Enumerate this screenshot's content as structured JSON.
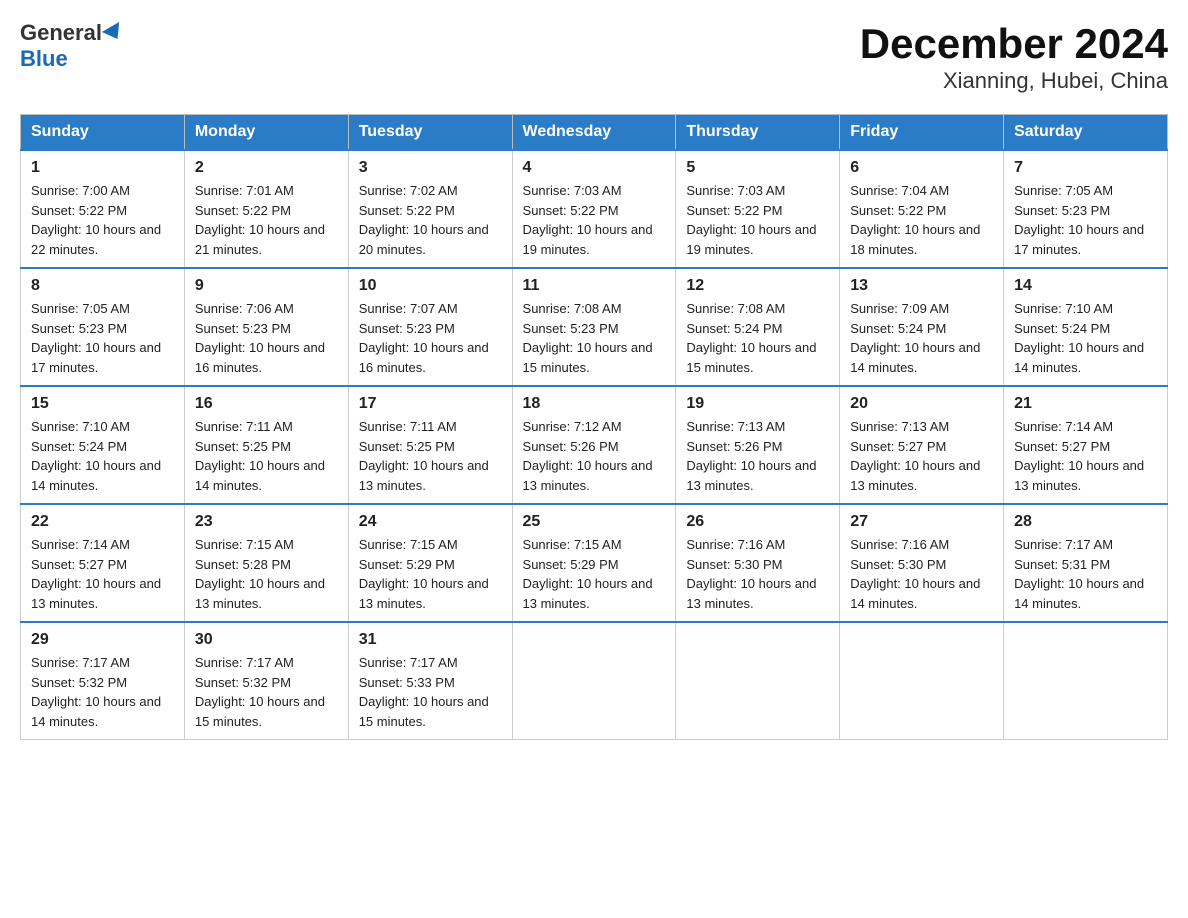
{
  "header": {
    "title": "December 2024",
    "subtitle": "Xianning, Hubei, China",
    "logo_general": "General",
    "logo_blue": "Blue"
  },
  "weekdays": [
    "Sunday",
    "Monday",
    "Tuesday",
    "Wednesday",
    "Thursday",
    "Friday",
    "Saturday"
  ],
  "weeks": [
    [
      {
        "day": "1",
        "sunrise": "7:00 AM",
        "sunset": "5:22 PM",
        "daylight": "10 hours and 22 minutes."
      },
      {
        "day": "2",
        "sunrise": "7:01 AM",
        "sunset": "5:22 PM",
        "daylight": "10 hours and 21 minutes."
      },
      {
        "day": "3",
        "sunrise": "7:02 AM",
        "sunset": "5:22 PM",
        "daylight": "10 hours and 20 minutes."
      },
      {
        "day": "4",
        "sunrise": "7:03 AM",
        "sunset": "5:22 PM",
        "daylight": "10 hours and 19 minutes."
      },
      {
        "day": "5",
        "sunrise": "7:03 AM",
        "sunset": "5:22 PM",
        "daylight": "10 hours and 19 minutes."
      },
      {
        "day": "6",
        "sunrise": "7:04 AM",
        "sunset": "5:22 PM",
        "daylight": "10 hours and 18 minutes."
      },
      {
        "day": "7",
        "sunrise": "7:05 AM",
        "sunset": "5:23 PM",
        "daylight": "10 hours and 17 minutes."
      }
    ],
    [
      {
        "day": "8",
        "sunrise": "7:05 AM",
        "sunset": "5:23 PM",
        "daylight": "10 hours and 17 minutes."
      },
      {
        "day": "9",
        "sunrise": "7:06 AM",
        "sunset": "5:23 PM",
        "daylight": "10 hours and 16 minutes."
      },
      {
        "day": "10",
        "sunrise": "7:07 AM",
        "sunset": "5:23 PM",
        "daylight": "10 hours and 16 minutes."
      },
      {
        "day": "11",
        "sunrise": "7:08 AM",
        "sunset": "5:23 PM",
        "daylight": "10 hours and 15 minutes."
      },
      {
        "day": "12",
        "sunrise": "7:08 AM",
        "sunset": "5:24 PM",
        "daylight": "10 hours and 15 minutes."
      },
      {
        "day": "13",
        "sunrise": "7:09 AM",
        "sunset": "5:24 PM",
        "daylight": "10 hours and 14 minutes."
      },
      {
        "day": "14",
        "sunrise": "7:10 AM",
        "sunset": "5:24 PM",
        "daylight": "10 hours and 14 minutes."
      }
    ],
    [
      {
        "day": "15",
        "sunrise": "7:10 AM",
        "sunset": "5:24 PM",
        "daylight": "10 hours and 14 minutes."
      },
      {
        "day": "16",
        "sunrise": "7:11 AM",
        "sunset": "5:25 PM",
        "daylight": "10 hours and 14 minutes."
      },
      {
        "day": "17",
        "sunrise": "7:11 AM",
        "sunset": "5:25 PM",
        "daylight": "10 hours and 13 minutes."
      },
      {
        "day": "18",
        "sunrise": "7:12 AM",
        "sunset": "5:26 PM",
        "daylight": "10 hours and 13 minutes."
      },
      {
        "day": "19",
        "sunrise": "7:13 AM",
        "sunset": "5:26 PM",
        "daylight": "10 hours and 13 minutes."
      },
      {
        "day": "20",
        "sunrise": "7:13 AM",
        "sunset": "5:27 PM",
        "daylight": "10 hours and 13 minutes."
      },
      {
        "day": "21",
        "sunrise": "7:14 AM",
        "sunset": "5:27 PM",
        "daylight": "10 hours and 13 minutes."
      }
    ],
    [
      {
        "day": "22",
        "sunrise": "7:14 AM",
        "sunset": "5:27 PM",
        "daylight": "10 hours and 13 minutes."
      },
      {
        "day": "23",
        "sunrise": "7:15 AM",
        "sunset": "5:28 PM",
        "daylight": "10 hours and 13 minutes."
      },
      {
        "day": "24",
        "sunrise": "7:15 AM",
        "sunset": "5:29 PM",
        "daylight": "10 hours and 13 minutes."
      },
      {
        "day": "25",
        "sunrise": "7:15 AM",
        "sunset": "5:29 PM",
        "daylight": "10 hours and 13 minutes."
      },
      {
        "day": "26",
        "sunrise": "7:16 AM",
        "sunset": "5:30 PM",
        "daylight": "10 hours and 13 minutes."
      },
      {
        "day": "27",
        "sunrise": "7:16 AM",
        "sunset": "5:30 PM",
        "daylight": "10 hours and 14 minutes."
      },
      {
        "day": "28",
        "sunrise": "7:17 AM",
        "sunset": "5:31 PM",
        "daylight": "10 hours and 14 minutes."
      }
    ],
    [
      {
        "day": "29",
        "sunrise": "7:17 AM",
        "sunset": "5:32 PM",
        "daylight": "10 hours and 14 minutes."
      },
      {
        "day": "30",
        "sunrise": "7:17 AM",
        "sunset": "5:32 PM",
        "daylight": "10 hours and 15 minutes."
      },
      {
        "day": "31",
        "sunrise": "7:17 AM",
        "sunset": "5:33 PM",
        "daylight": "10 hours and 15 minutes."
      },
      null,
      null,
      null,
      null
    ]
  ]
}
